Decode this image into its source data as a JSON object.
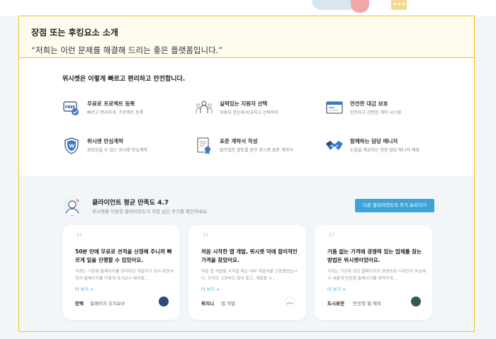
{
  "callout": {
    "title": "장점 또는 후킹요소 소개",
    "quote": "“저희는 이런 문제를 해결해 드리는 좋은 플랫폼입니다.”"
  },
  "features": {
    "title": "위시켓은 이렇게 빠르고 편리하고 안전합니다.",
    "items": [
      {
        "title": "무료로 프로젝트 등록",
        "desc": "빠르고 편리하게, 프로젝트 등록",
        "icon": "free-tag-icon"
      },
      {
        "title": "실력있는 지원자 선택",
        "desc": "지원자 한눈에 비교하고 선택까지",
        "icon": "people-group-icon"
      },
      {
        "title": "안전한 대금 보호",
        "desc": "안전하고 간편한 계약 시스템",
        "icon": "browser-window-icon"
      },
      {
        "title": "위시켓 안심계약",
        "desc": "보호받을 수 있는 위시켓 안심계약",
        "icon": "shield-icon"
      },
      {
        "title": "표준 계약서 작성",
        "desc": "법무법인 검토를 받은 위시켓 표준 계약서",
        "icon": "contract-document-icon"
      },
      {
        "title": "함께하는 담당 매니저",
        "desc": "도움을 제공하는 전문 담당 매니저 배정",
        "icon": "handshake-icon"
      }
    ]
  },
  "reviews": {
    "title": "클라이언트 평균 만족도 4.7",
    "subtitle": "위시켓을 이용한 클라이언트가 직접 남긴 후기를 확인하세요.",
    "button": "다른 클라이언트의 후기 보러가기",
    "more_label": "더 보기",
    "cards": [
      {
        "title": "50분 만에 무료로 견적을 산정해 주니까 빠르게 일을 진행할 수 있었어요.",
        "body": "저희는 기존에 홈페이지를 관리하던 개발자가 회사 하면서 회사 홈페이지를 어떻게 유지보수 해야할…",
        "company": "린백",
        "project": "홈페이지 유지보수",
        "logo_color": "#2b4a7a"
      },
      {
        "title": "처음 시작한 앱 개발, 위시켓 덕에 합리적인 가격을 찾았어요.",
        "body": "처음 앱 개발을 시작할 때는 내부 개발자를 고용했었습니다. 하지만 고정비도 많이 들고, 개발할 수…",
        "company": "위지니",
        "project": "앱 개발",
        "logo_color": "#6fb4dc"
      },
      {
        "title": "거품 없는 가격에 경쟁력 있는 업체를 찾는 방법은 위시켓이었어요.",
        "body": "저희는 기존에 있던 홈페이지의 콘텐츠와 디자인이 부실해서 새롭게 반응형 홈페이지를 제작하게…",
        "company": "도시유전",
        "project": "반응형 웹 제작",
        "logo_color": "#2f5d4a"
      }
    ]
  },
  "colors": {
    "accent": "#3ea4d8",
    "highlight_border": "#f0c419",
    "callout_bg": "#fffbef"
  }
}
